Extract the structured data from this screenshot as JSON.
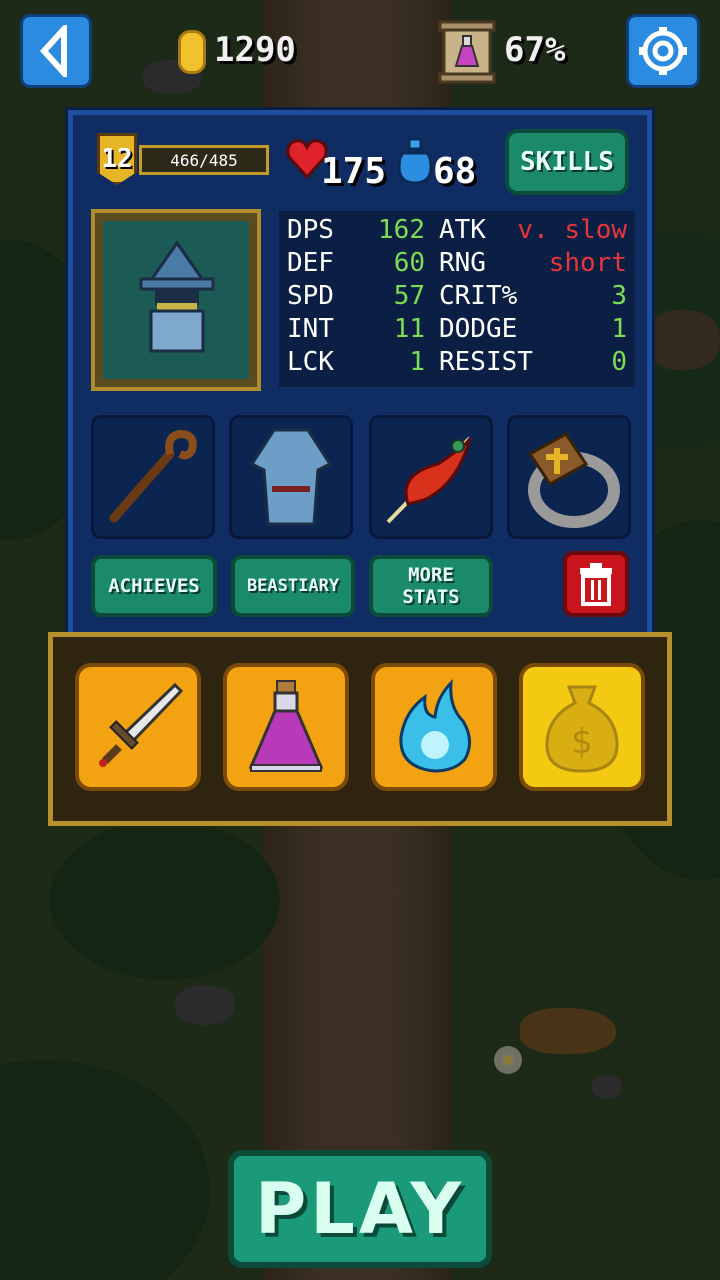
{
  "topbar": {
    "coins": "1290",
    "potion_percent": "67%",
    "icons": [
      "back-arrow-icon",
      "coin-icon",
      "potion-scroll-icon",
      "settings-gear-icon"
    ],
    "accent": "#2a8be0"
  },
  "character": {
    "level": "12",
    "xp": "466/485",
    "hp": "175",
    "mana": "68",
    "skills_label": "SKILLS",
    "portrait": "wizard-portrait-icon"
  },
  "stats": [
    {
      "label1": "DPS",
      "value1": "162",
      "label2": "ATK",
      "value2": "v. slow",
      "color2": "#e8353b"
    },
    {
      "label1": "DEF",
      "value1": "60",
      "label2": "RNG",
      "value2": "short",
      "color2": "#e8353b"
    },
    {
      "label1": "SPD",
      "value1": "57",
      "label2": "CRIT%",
      "value2": "3",
      "color2": "#7ddc55"
    },
    {
      "label1": "INT",
      "value1": "11",
      "label2": "DODGE",
      "value2": "1",
      "color2": "#7ddc55"
    },
    {
      "label1": "LCK",
      "value1": "1",
      "label2": "RESIST",
      "value2": "0",
      "color2": "#7ddc55"
    }
  ],
  "equipment": [
    "staff-icon",
    "robe-icon",
    "phoenix-feather-icon",
    "shield-ring-icon"
  ],
  "buttons": {
    "achieves": "ACHIEVES",
    "beastiary": "BEASTIARY",
    "more_stats_1": "MORE",
    "more_stats_2": "STATS",
    "play": "PLAY"
  },
  "quick_items": [
    "sword-icon",
    "potion-icon",
    "blue-flame-icon",
    "money-bag-icon"
  ]
}
